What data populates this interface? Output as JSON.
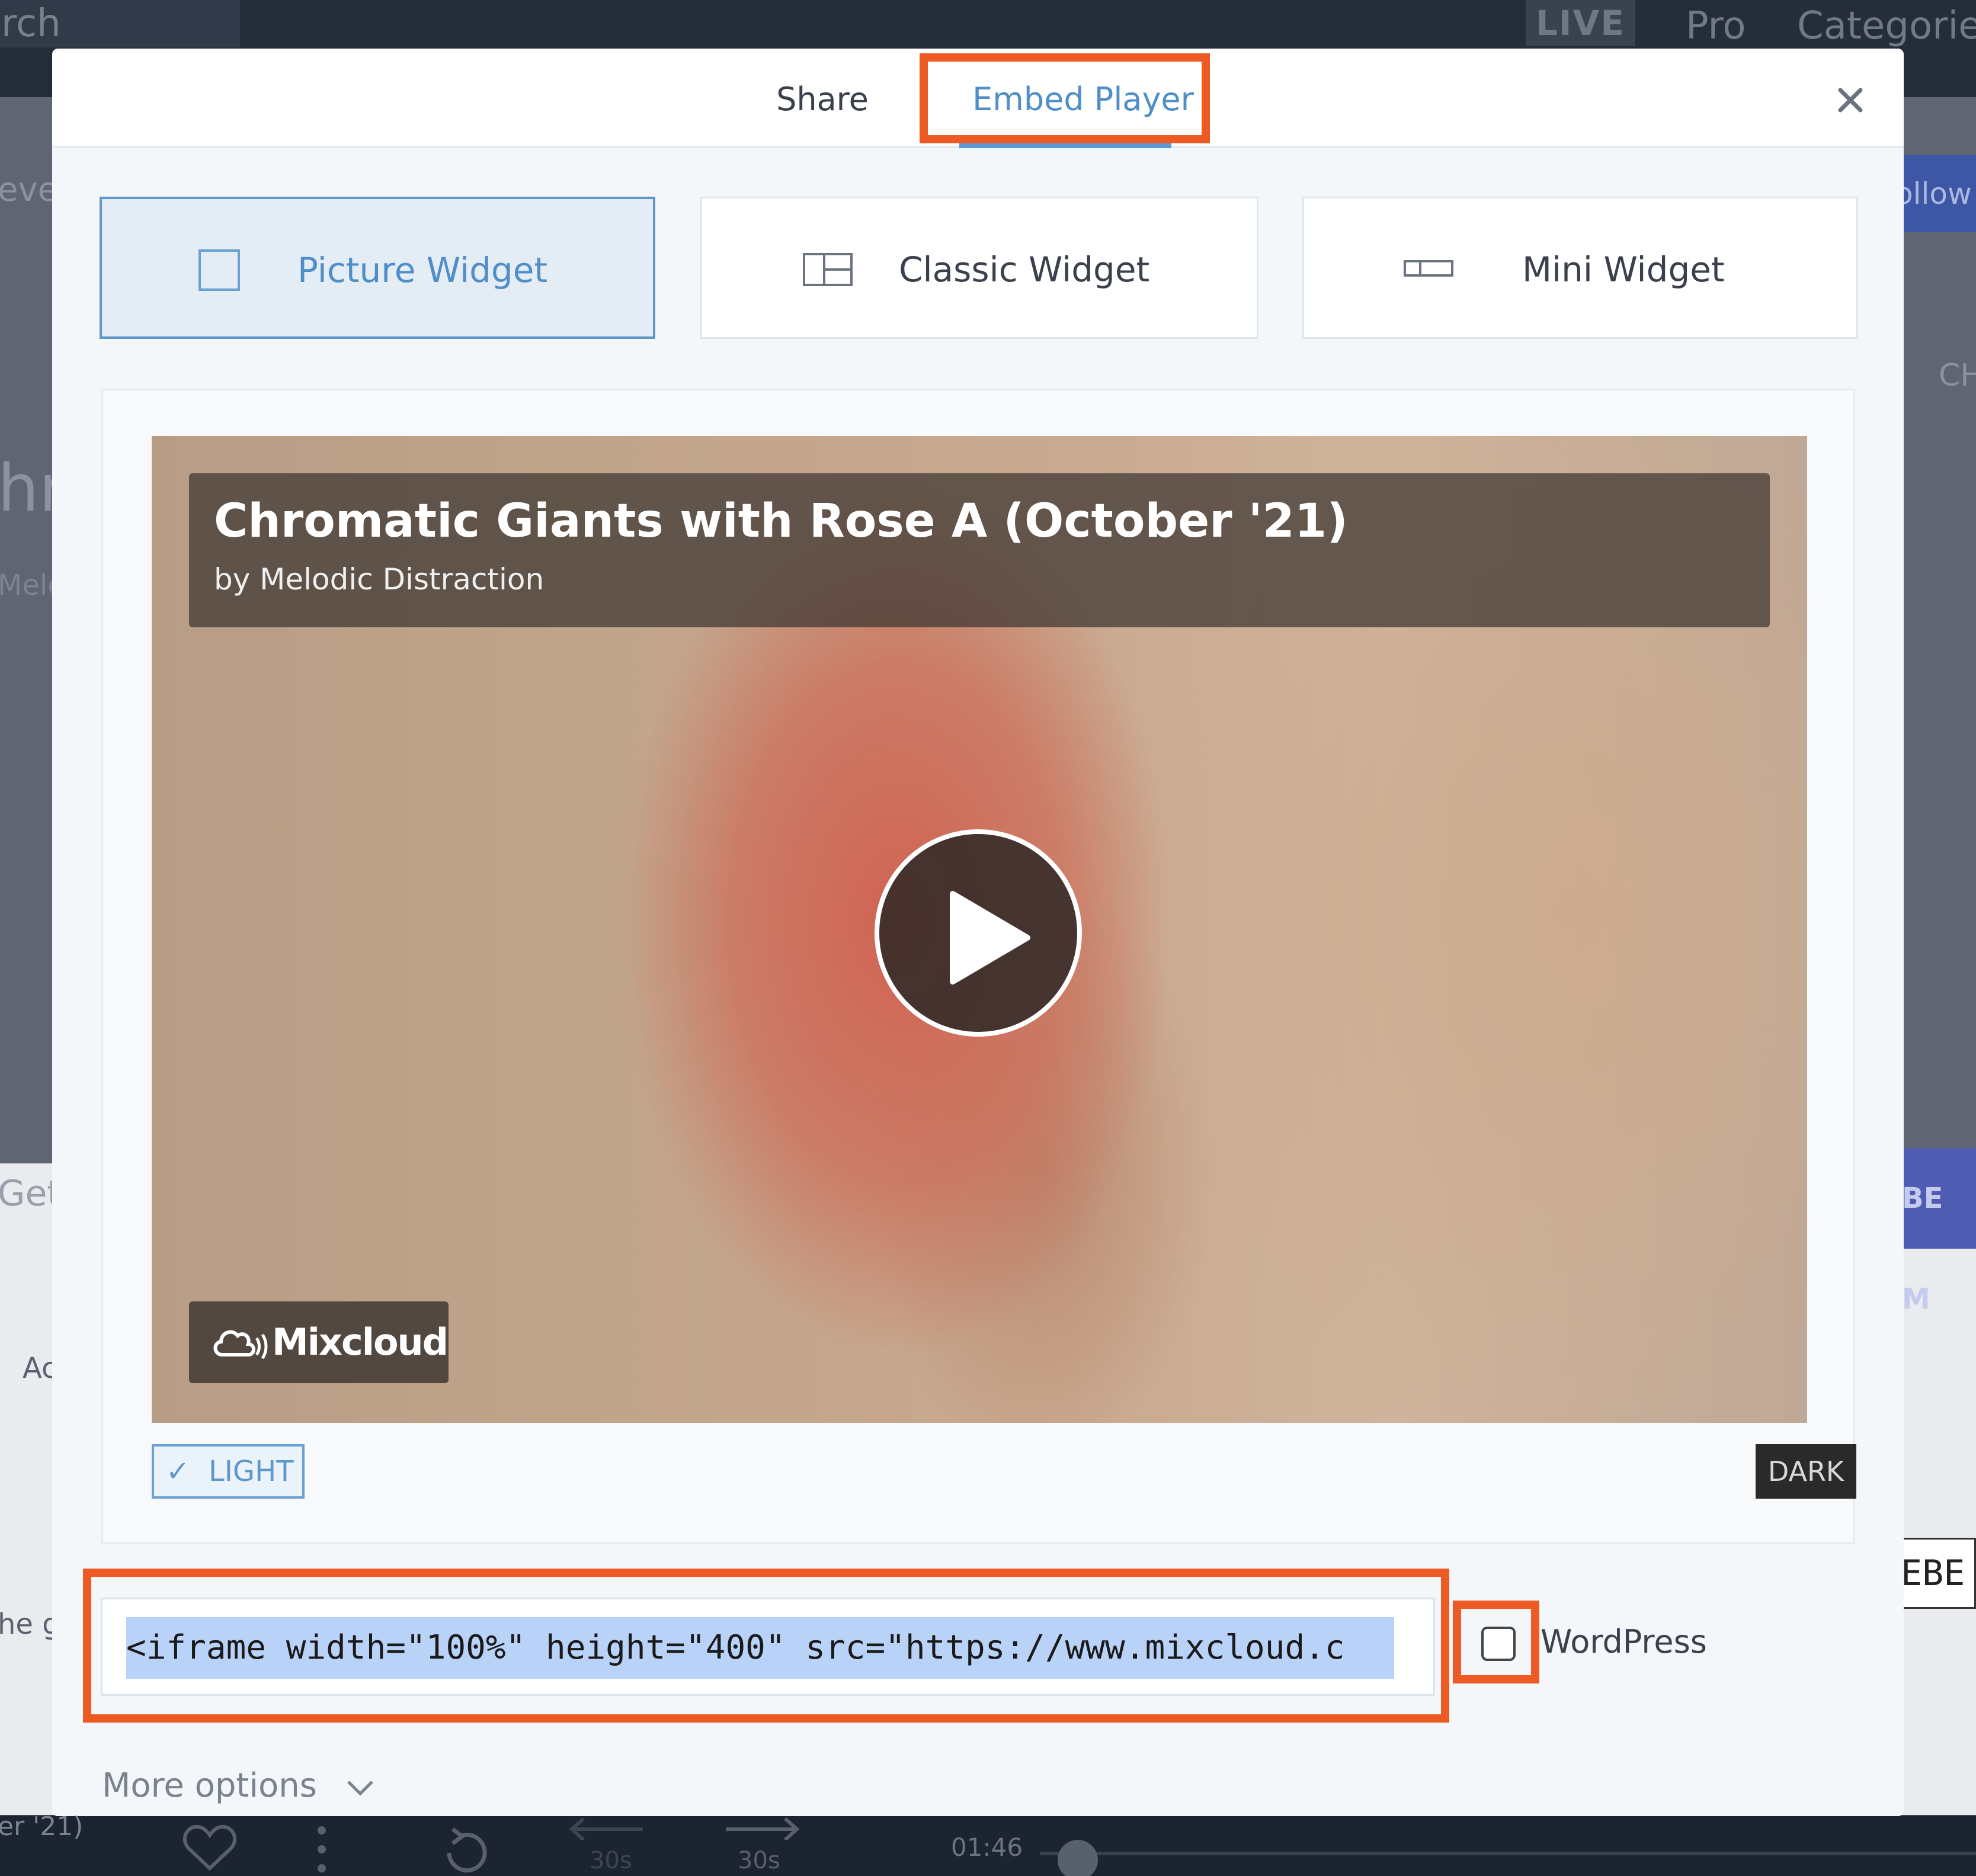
{
  "background": {
    "search_text": "rch",
    "live_label": "LIVE",
    "nav": [
      "Pro",
      "Categorie"
    ],
    "left_edge": [
      "eve",
      "hr",
      "Melc",
      "Get",
      "Ac",
      "he g",
      "er '21)"
    ],
    "right_edge": [
      "ollow",
      "CH",
      "BE M",
      "EBE"
    ],
    "player": {
      "rewind_label": "30s",
      "forward_label": "30s",
      "time": "01:46"
    }
  },
  "modal": {
    "tabs": [
      {
        "label": "Share",
        "active": false
      },
      {
        "label": "Embed Player",
        "active": true
      }
    ],
    "close_icon": "close-icon",
    "widgets": [
      {
        "label": "Picture Widget",
        "icon": "picture-widget-icon",
        "selected": true
      },
      {
        "label": "Classic Widget",
        "icon": "classic-widget-icon",
        "selected": false
      },
      {
        "label": "Mini Widget",
        "icon": "mini-widget-icon",
        "selected": false
      }
    ],
    "preview": {
      "show_title": "Chromatic Giants with Rose A (October '21)",
      "artist": "by Melodic Distraction",
      "brand": "Mixcloud",
      "play_icon": "play-icon"
    },
    "theme": {
      "light_label": "LIGHT",
      "dark_label": "DARK",
      "selected": "light"
    },
    "embed_code": "<iframe width=\"100%\" height=\"400\" src=\"https://www.mixcloud.c",
    "wordpress_label": "WordPress",
    "wordpress_checked": false,
    "more_options_label": "More options"
  },
  "colors": {
    "accent": "#4f8ec9",
    "highlight": "#ee5a24",
    "selection": "#b9d2f8",
    "modal_bg": "#f4f7fa"
  }
}
